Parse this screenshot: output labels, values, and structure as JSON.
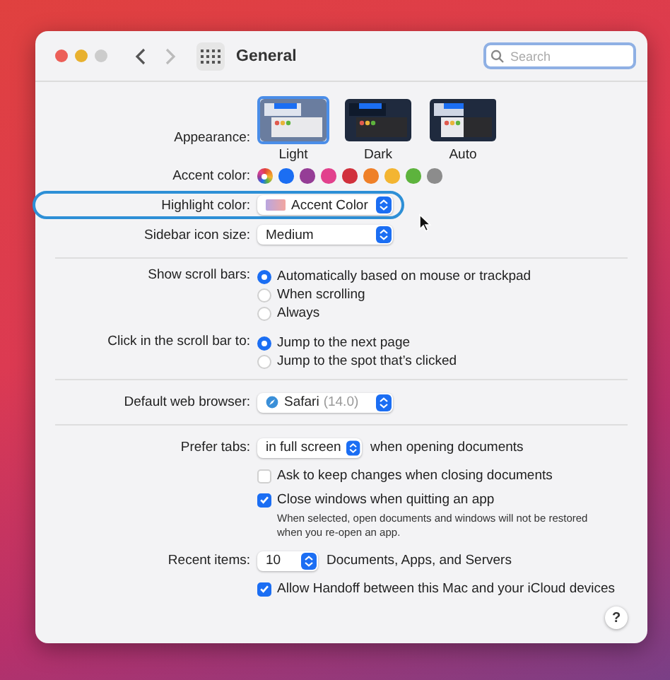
{
  "window": {
    "title": "General",
    "search_placeholder": "Search"
  },
  "appearance": {
    "label": "Appearance:",
    "options": [
      {
        "label": "Light",
        "kind": "light",
        "selected": true
      },
      {
        "label": "Dark",
        "kind": "dark",
        "selected": false
      },
      {
        "label": "Auto",
        "kind": "auto",
        "selected": false
      }
    ]
  },
  "accent": {
    "label": "Accent color:",
    "colors": [
      {
        "kind": "multicolor",
        "selected": true
      },
      {
        "kind": "solid",
        "color": "#1b6ef3",
        "selected": false
      },
      {
        "kind": "solid",
        "color": "#953d96",
        "selected": false
      },
      {
        "kind": "solid",
        "color": "#e2418d",
        "selected": false
      },
      {
        "kind": "solid",
        "color": "#d1313d",
        "selected": false
      },
      {
        "kind": "solid",
        "color": "#ef8028",
        "selected": false
      },
      {
        "kind": "solid",
        "color": "#f3b532",
        "selected": false
      },
      {
        "kind": "solid",
        "color": "#5db33d",
        "selected": false
      },
      {
        "kind": "solid",
        "color": "#8c8c8c",
        "selected": false
      }
    ]
  },
  "highlight": {
    "label": "Highlight color:",
    "value": "Accent Color",
    "focused": true
  },
  "sidebar_icon_size": {
    "label": "Sidebar icon size:",
    "value": "Medium",
    "focused": false
  },
  "scroll_bars": {
    "label": "Show scroll bars:",
    "options": [
      {
        "label": "Automatically based on mouse or trackpad",
        "selected": true
      },
      {
        "label": "When scrolling",
        "selected": false
      },
      {
        "label": "Always",
        "selected": false
      }
    ]
  },
  "click_scroll": {
    "label": "Click in the scroll bar to:",
    "options": [
      {
        "label": "Jump to the next page",
        "selected": true
      },
      {
        "label": "Jump to the spot that’s clicked",
        "selected": false
      }
    ]
  },
  "browser": {
    "label": "Default web browser:",
    "value": "Safari",
    "version": "(14.0)"
  },
  "prefer_tabs": {
    "label": "Prefer tabs:",
    "value": "in full screen",
    "suffix": "when opening documents"
  },
  "checkboxes": [
    {
      "label": "Ask to keep changes when closing documents",
      "checked": false
    },
    {
      "label": "Close windows when quitting an app",
      "checked": true,
      "note": "When selected, open documents and windows will not be restored when you re-open an app."
    }
  ],
  "recent_items": {
    "label": "Recent items:",
    "value": "10",
    "suffix": "Documents, Apps, and Servers"
  },
  "handoff": {
    "label": "Allow Handoff between this Mac and your iCloud devices",
    "checked": true
  },
  "help": "?"
}
